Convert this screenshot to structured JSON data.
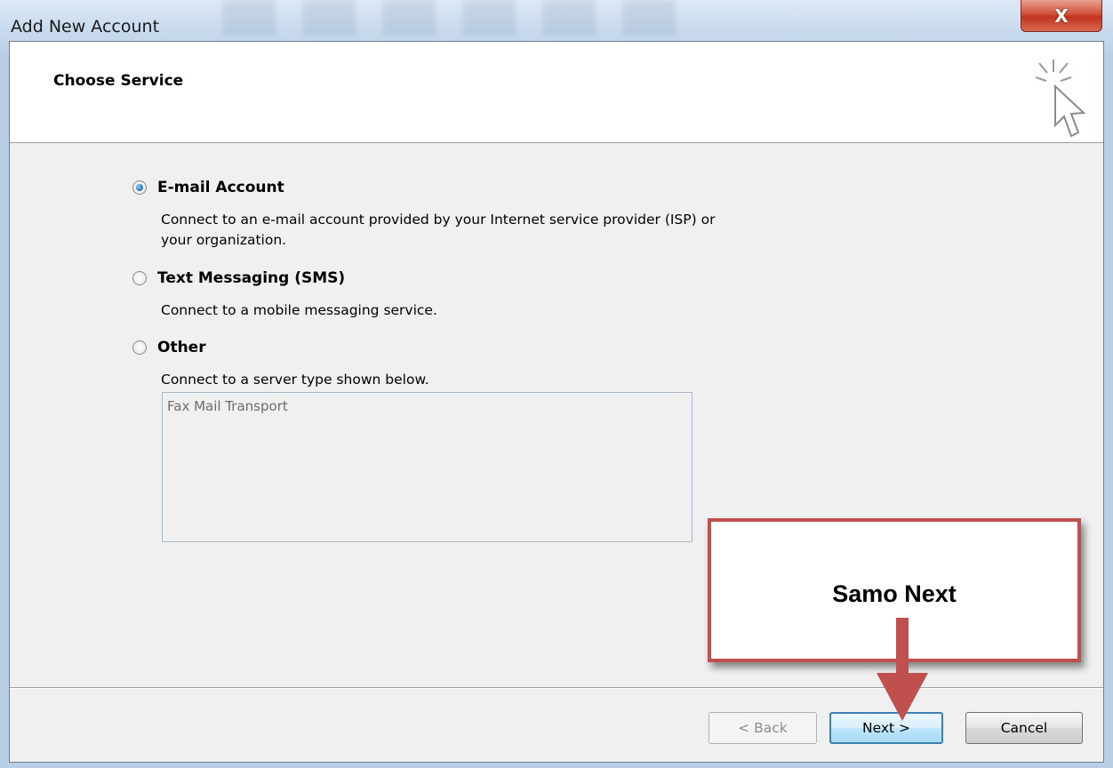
{
  "window": {
    "title": "Add New Account",
    "close_label": "X"
  },
  "header": {
    "title": "Choose Service"
  },
  "options": [
    {
      "label": "E-mail Account",
      "description_line1": "Connect to an e-mail account provided by your Internet service provider (ISP) or",
      "description_line2": "your organization.",
      "selected": true
    },
    {
      "label": "Text Messaging (SMS)",
      "description_line1": "Connect to a mobile messaging service.",
      "selected": false
    },
    {
      "label": "Other",
      "description_line1": "Connect to a server type shown below.",
      "selected": false
    }
  ],
  "server_types": [
    "Fax Mail Transport"
  ],
  "buttons": {
    "back": "< Back",
    "next": "Next >",
    "cancel": "Cancel"
  },
  "annotation": {
    "text": "Samo Next",
    "color": "#c0504d"
  },
  "colors": {
    "accent": "#3c7fb1",
    "close": "#c1341f"
  }
}
